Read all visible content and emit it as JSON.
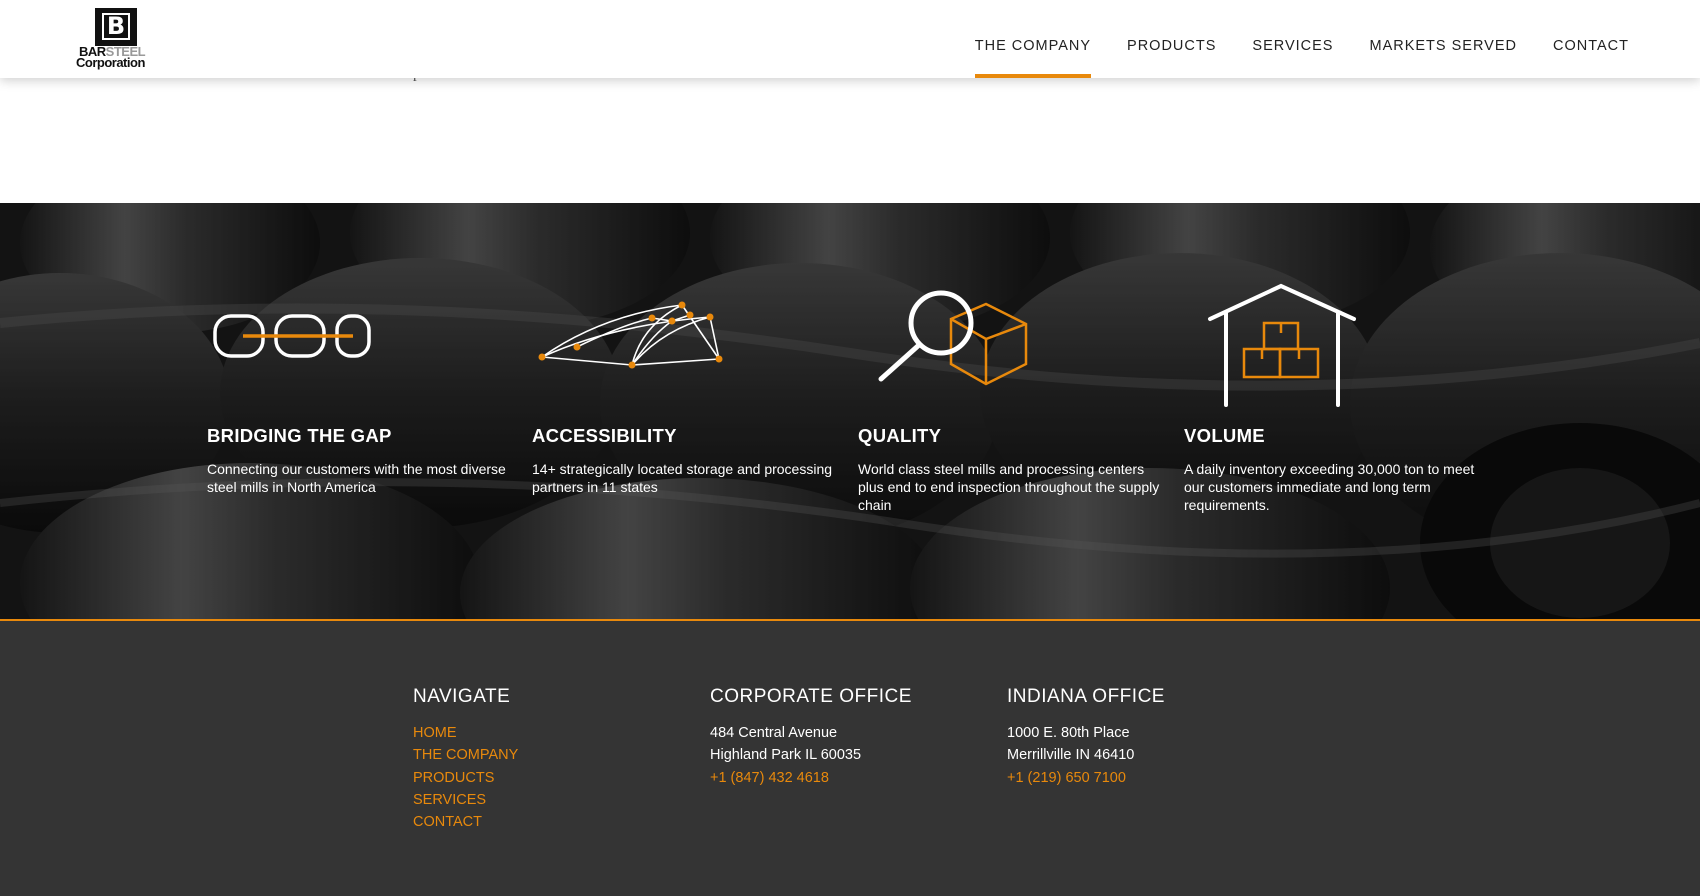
{
  "brand": {
    "logo_letter": "B",
    "name_part1": "BAR",
    "name_part2": "STEEL",
    "name_line2": "Corporation"
  },
  "nav": {
    "items": [
      {
        "label": "THE COMPANY",
        "active": true
      },
      {
        "label": "PRODUCTS",
        "active": false
      },
      {
        "label": "SERVICES",
        "active": false
      },
      {
        "label": "MARKETS SERVED",
        "active": false
      },
      {
        "label": "CONTACT",
        "active": false
      }
    ]
  },
  "partial_text": "pride ourselves on our culture of teamwork and collaboration.",
  "features": [
    {
      "icon": "chain-links-icon",
      "title": "BRIDGING THE GAP",
      "description": "Connecting our customers with the most diverse steel mills in North America"
    },
    {
      "icon": "network-icon",
      "title": "ACCESSIBILITY",
      "description": "14+ strategically located storage and processing partners in 11 states"
    },
    {
      "icon": "magnifier-box-icon",
      "title": "QUALITY",
      "description": "World class steel mills and processing centers plus end to end inspection throughout the supply chain"
    },
    {
      "icon": "warehouse-icon",
      "title": "VOLUME",
      "description": "A daily inventory exceeding 30,000 ton to meet our customers immediate and long term requirements."
    }
  ],
  "footer": {
    "navigate": {
      "heading": "NAVIGATE",
      "links": [
        "HOME",
        "THE COMPANY",
        "PRODUCTS",
        "SERVICES",
        "CONTACT"
      ]
    },
    "corporate": {
      "heading": "CORPORATE OFFICE",
      "address1": "484 Central Avenue",
      "address2": "Highland Park IL 60035",
      "phone": "+1 (847) 432 4618"
    },
    "indiana": {
      "heading": "INDIANA OFFICE",
      "address1": "1000 E. 80th Place",
      "address2": "Merrillville IN 46410",
      "phone": "+1 (219) 650 7100"
    }
  },
  "colors": {
    "accent": "#e8890c",
    "footer_bg": "#343434",
    "text_dark": "#222222"
  }
}
